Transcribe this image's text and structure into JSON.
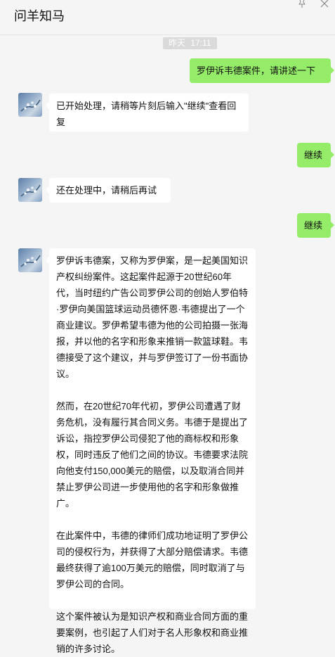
{
  "header": {
    "title": "问羊知马",
    "pin_icon": "pin-icon",
    "close_icon": "close-icon"
  },
  "timestamp": {
    "day": "昨天",
    "time": "17:11"
  },
  "messages": [
    {
      "side": "right",
      "text": "罗伊诉韦德案件，请讲述一下"
    },
    {
      "side": "left",
      "text": "已开始处理，请稍等片刻后输入\"继续\"查看回复"
    },
    {
      "side": "right",
      "text": "继续"
    },
    {
      "side": "left",
      "text": "还在处理中，请稍后再试"
    },
    {
      "side": "right",
      "text": "继续"
    },
    {
      "side": "left",
      "paragraphs": [
        "罗伊诉韦德案，又称为罗伊案，是一起美国知识产权纠纷案件。这起案件起源于20世纪60年代，当时纽约广告公司罗伊公司的创始人罗伯特·罗伊向美国篮球运动员德怀恩·韦德提出了一个商业建议。罗伊希望韦德为他的公司拍摄一张海报，并以他的名字和形象来推销一款篮球鞋。韦德接受了这个建议，并与罗伊签订了一份书面协议。",
        "然而，在20世纪70年代初，罗伊公司遭遇了财务危机，没有履行其合同义务。韦德于是提出了诉讼，指控罗伊公司侵犯了他的商标权和形象权，同时违反了他们之间的协议。韦德要求法院向他支付150,000美元的赔偿，以及取消合同并禁止罗伊公司进一步使用他的名字和形象做推广。",
        "在此案件中，韦德的律师们成功地证明了罗伊公司的侵权行为，并获得了大部分赔偿请求。韦德最终获得了逾100万美元的赔偿，同时取消了与罗伊公司的合同。",
        "这个案件被认为是知识产权和商业合同方面的重要案例，也引起了人们对于名人形象权和商业推销的许多讨论。"
      ]
    }
  ],
  "avatar_icon": "avatar"
}
